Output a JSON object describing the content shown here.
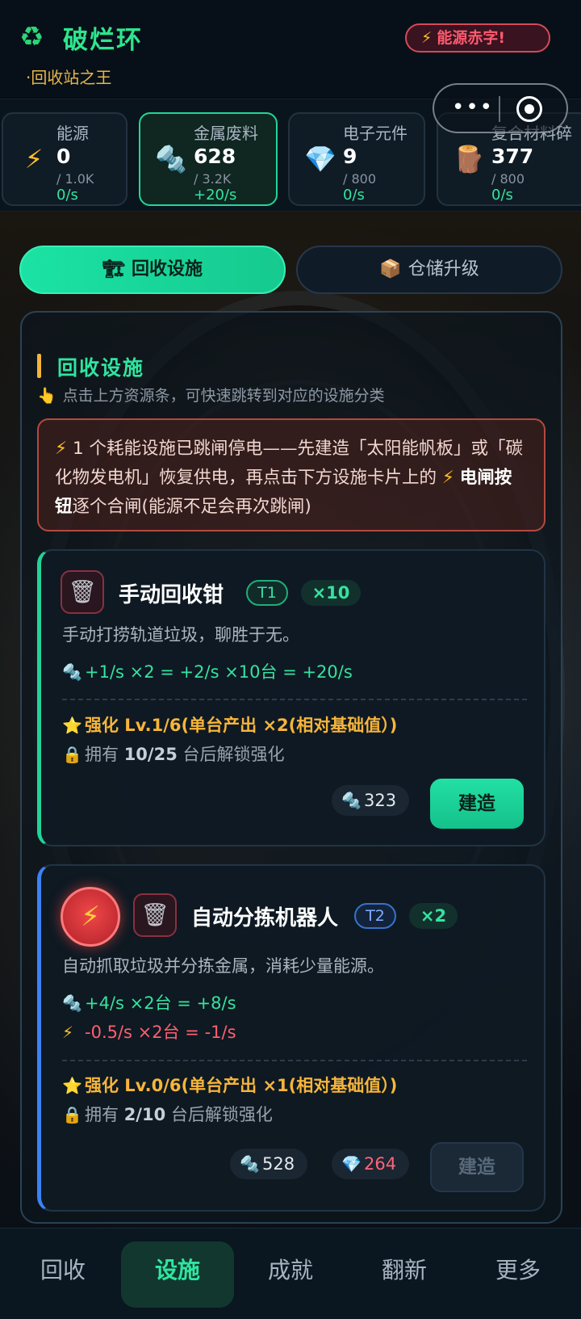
{
  "header": {
    "logo_icon": "recycle-icon",
    "title": "破烂环",
    "subtitle": "·回收站之王",
    "deficit_badge": "能源赤字!"
  },
  "resources": [
    {
      "name": "能源",
      "icon": "bolt-icon",
      "value": "0",
      "cap": "/ 1.0K",
      "rate": "0/s",
      "active": false
    },
    {
      "name": "金属废料",
      "icon": "scrap-metal-icon",
      "value": "628",
      "cap": "/ 3.2K",
      "rate": "+20/s",
      "active": true
    },
    {
      "name": "电子元件",
      "icon": "diamond-icon",
      "value": "9",
      "cap": "/ 800",
      "rate": "0/s",
      "active": false
    },
    {
      "name": "复合材料碎",
      "icon": "log-icon",
      "value": "377",
      "cap": "/ 800",
      "rate": "0/s",
      "active": false
    }
  ],
  "tabs": [
    {
      "label": "回收设施",
      "icon": "crane-icon"
    },
    {
      "label": "仓储升级",
      "icon": "box-icon"
    }
  ],
  "section": {
    "title": "回收设施",
    "hint": "点击上方资源条，可快速跳转到对应的设施分类"
  },
  "alert": {
    "part1": "1 个耗能设施已跳闸停电——先建造「太阳能帆板」或「碳化物发电机」恢复供电，再点击下方设施卡片上的",
    "bold": "电闸按钮",
    "part2": "逐个合闸(能源不足会再次跳闸)"
  },
  "facilities": [
    {
      "name": "手动回收钳",
      "tier": "T1",
      "count": "×10",
      "desc": "手动打捞轨道垃圾，聊胜于无。",
      "prod_line": "+1/s ×2 = +2/s ×10台 = +20/s",
      "upgrade": "强化 Lv.1/6(单台产出 ×2(相对基础值）)",
      "lock_pre": "拥有 ",
      "lock_num": "10/25",
      "lock_post": " 台后解锁强化",
      "cost_metal": "323",
      "build_label": "建造"
    },
    {
      "name": "自动分拣机器人",
      "tier": "T2",
      "count": "×2",
      "desc": "自动抓取垃圾并分拣金属，消耗少量能源。",
      "prod_line": "+4/s ×2台 = +8/s",
      "cons_line": "-0.5/s ×2台 = -1/s",
      "upgrade": "强化 Lv.0/6(单台产出 ×1(相对基础值）)",
      "lock_pre": "拥有 ",
      "lock_num": "2/10",
      "lock_post": " 台后解锁强化",
      "cost_metal": "528",
      "cost_crystal": "264",
      "build_label": "建造"
    }
  ],
  "bottom_nav": [
    {
      "label": "回收",
      "active": false
    },
    {
      "label": "设施",
      "active": true
    },
    {
      "label": "成就",
      "active": false
    },
    {
      "label": "翻新",
      "active": false
    },
    {
      "label": "更多",
      "active": false
    }
  ],
  "colors": {
    "accent": "#2fe5a0",
    "warning": "#f6b53a",
    "danger": "#ff5f70",
    "background": "#070d14"
  }
}
